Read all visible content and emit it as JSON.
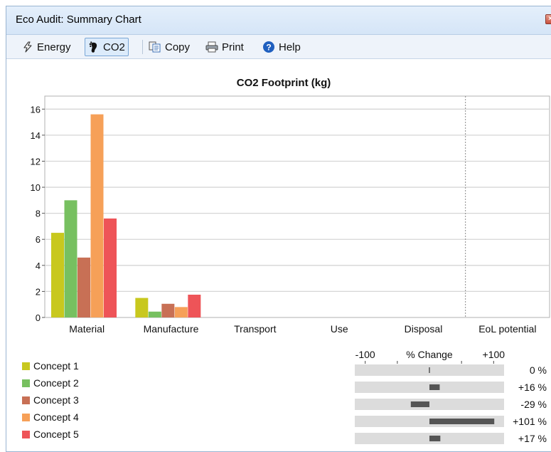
{
  "window": {
    "title": "Eco Audit: Summary Chart",
    "close_label": "×"
  },
  "toolbar": {
    "energy_label": "Energy",
    "co2_label": "CO2",
    "copy_label": "Copy",
    "print_label": "Print",
    "help_label": "Help",
    "active": "co2",
    "icons": {
      "energy": "lightning-icon",
      "co2": "footprint-icon",
      "copy": "copy-icon",
      "print": "printer-icon",
      "help": "help-icon"
    }
  },
  "chart_data": {
    "type": "bar",
    "title": "CO2 Footprint (kg)",
    "xlabel": "",
    "ylabel": "",
    "ylim": [
      0,
      17
    ],
    "yticks": [
      "0",
      "2",
      "4",
      "6",
      "8",
      "10",
      "12",
      "14",
      "16"
    ],
    "categories": [
      "Material",
      "Manufacture",
      "Transport",
      "Use",
      "Disposal",
      "EoL potential"
    ],
    "grid": true,
    "legend_position": "bottom-left",
    "series": [
      {
        "name": "Concept 1",
        "color": "#c8c81e",
        "values": [
          6.5,
          1.5,
          0,
          0,
          0,
          0
        ]
      },
      {
        "name": "Concept 2",
        "color": "#77c060",
        "values": [
          9.0,
          0.45,
          0,
          0,
          0,
          0
        ]
      },
      {
        "name": "Concept 3",
        "color": "#c87055",
        "values": [
          4.6,
          1.05,
          0,
          0,
          0,
          0
        ]
      },
      {
        "name": "Concept 4",
        "color": "#f6a058",
        "values": [
          15.6,
          0.8,
          0,
          0,
          0,
          0
        ]
      },
      {
        "name": "Concept 5",
        "color": "#ee5458",
        "values": [
          7.6,
          1.75,
          0,
          0,
          0,
          0
        ]
      }
    ],
    "percent_change": {
      "header": "% Change",
      "min_label": "-100",
      "max_label": "+100",
      "range": [
        -100,
        100
      ],
      "values": [
        0,
        16,
        -29,
        101,
        17
      ],
      "labels": [
        "0 %",
        "+16 %",
        "-29 %",
        "+101 %",
        "+17 %"
      ]
    }
  }
}
